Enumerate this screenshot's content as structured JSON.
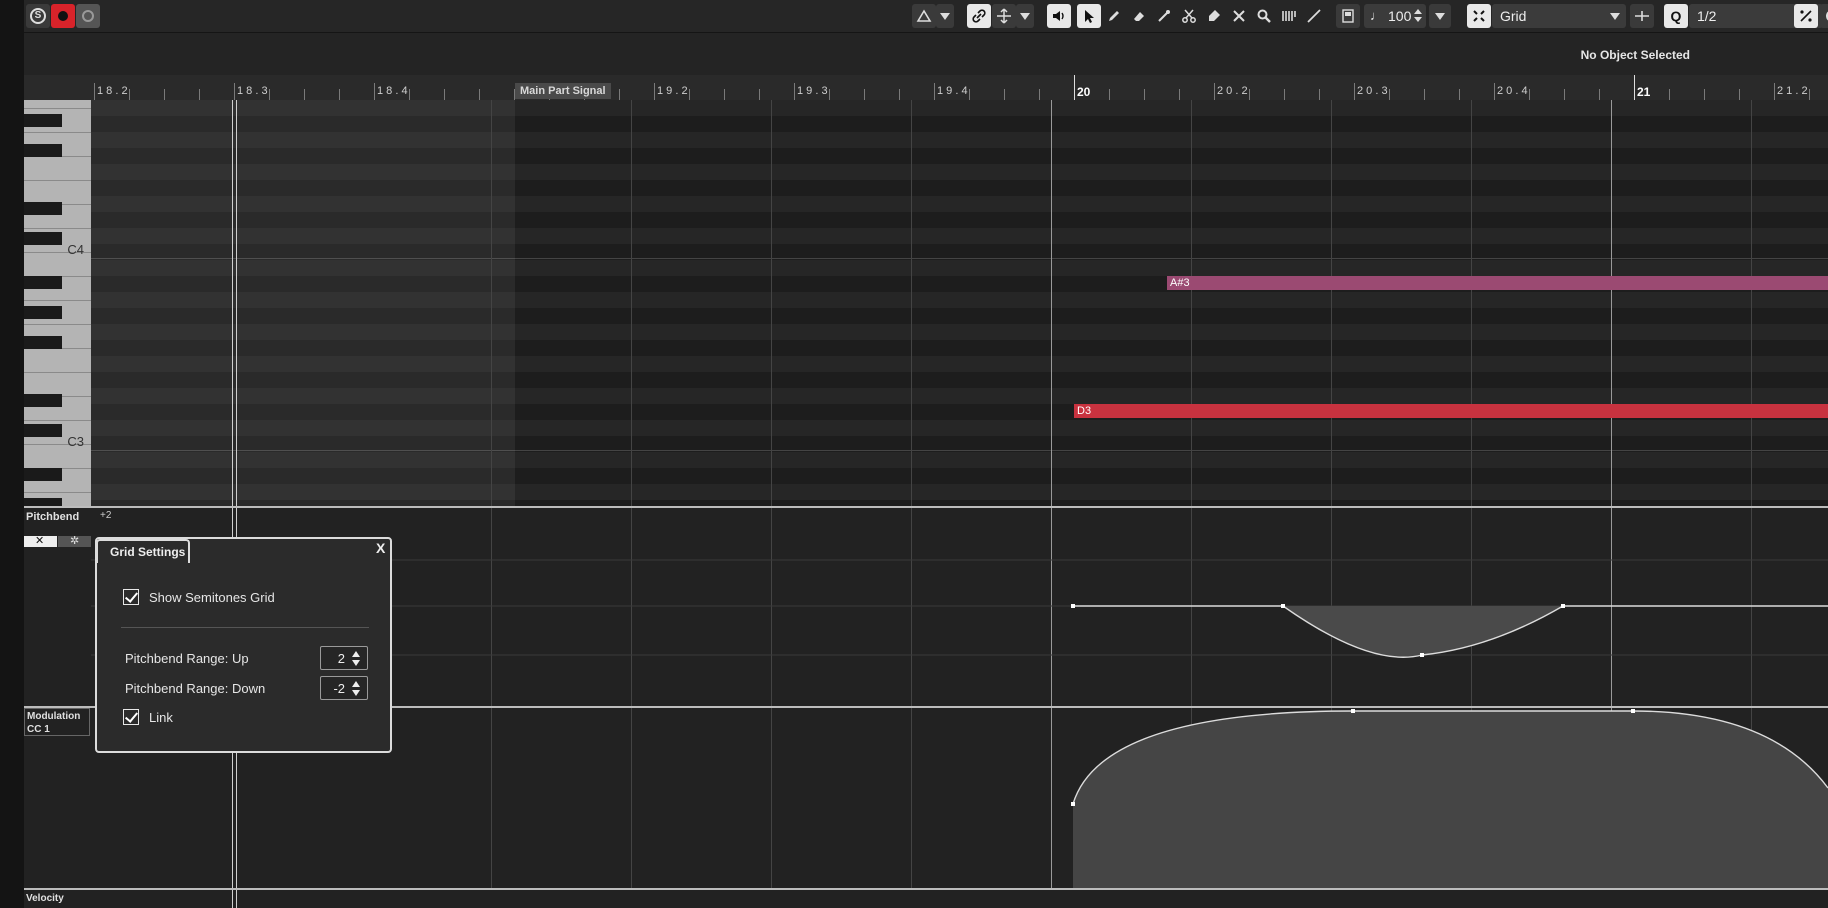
{
  "toolbar": {
    "solo_label": "S",
    "velocity_value": "100",
    "snap_type": "Grid",
    "quantize_label": "Q",
    "quantize_value": "1/2"
  },
  "infobar": {
    "selection_status": "No Object Selected"
  },
  "ruler": {
    "ticks": [
      {
        "label": "18.2"
      },
      {
        "label": "18.3"
      },
      {
        "label": "18.4"
      },
      {
        "label": "19.2"
      },
      {
        "label": "19.3"
      },
      {
        "label": "19.4"
      },
      {
        "label": "20"
      },
      {
        "label": "20.2"
      },
      {
        "label": "20.3"
      },
      {
        "label": "20.4"
      },
      {
        "label": "21"
      },
      {
        "label": "21.2"
      }
    ],
    "part_name": "Main Part Signal"
  },
  "keyboard": {
    "octave_labels": [
      "C4",
      "C3"
    ]
  },
  "notes": [
    {
      "label": "A#3",
      "color": "#9b4a72"
    },
    {
      "label": "D3",
      "color": "#c8323f"
    }
  ],
  "pitchbend": {
    "lane_name": "Pitchbend",
    "top_value": "+2"
  },
  "modulation": {
    "lane_name": "Modulation",
    "cc_label": "CC 1"
  },
  "velocity": {
    "lane_name": "Velocity"
  },
  "grid_settings": {
    "title": "Grid Settings",
    "close_label": "X",
    "show_semitones_label": "Show Semitones Grid",
    "range_up_label": "Pitchbend Range: Up",
    "range_up_value": "2",
    "range_down_label": "Pitchbend Range: Down",
    "range_down_value": "-2",
    "link_label": "Link"
  },
  "colors": {
    "accent_record": "#d8232a",
    "note_pink": "#9b4a72",
    "note_red": "#c8323f"
  },
  "icons": [
    "solo-icon",
    "record-icon",
    "monitor-icon",
    "auto-scroll-icon",
    "link-icon",
    "move-icon",
    "speaker-icon",
    "pointer-icon",
    "pencil-icon",
    "eraser-icon",
    "line-icon",
    "scissors-icon",
    "glue-icon",
    "mute-icon",
    "zoom-icon",
    "color-icon",
    "draw-icon",
    "note-icon",
    "snap-icon",
    "quantize-icon"
  ]
}
